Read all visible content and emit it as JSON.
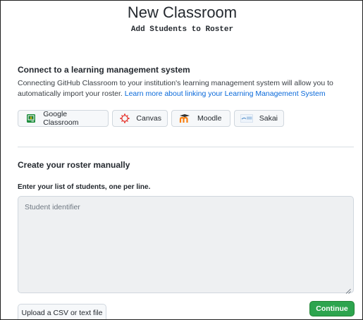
{
  "header": {
    "title": "New Classroom",
    "subtitle": "Add Students to Roster"
  },
  "lms": {
    "heading": "Connect to a learning management system",
    "description": "Connecting GitHub Classroom to your institution's learning management system will allow you to automatically import your roster.",
    "learn_more": "Learn more about linking your Learning Management System",
    "buttons": [
      {
        "label": "Google Classroom",
        "icon": "google-classroom-icon"
      },
      {
        "label": "Canvas",
        "icon": "canvas-icon"
      },
      {
        "label": "Moodle",
        "icon": "moodle-icon"
      },
      {
        "label": "Sakai",
        "icon": "sakai-icon"
      }
    ]
  },
  "manual": {
    "heading": "Create your roster manually",
    "label": "Enter your list of students, one per line.",
    "placeholder": "Student identifier",
    "upload_label": "Upload a CSV or text file",
    "continue_label": "Continue"
  },
  "colors": {
    "accent_link": "#0969da",
    "continue_green": "#2da44e"
  }
}
